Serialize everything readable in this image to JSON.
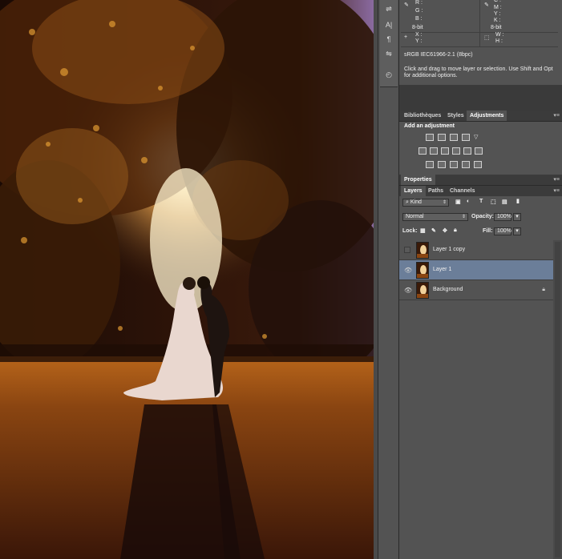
{
  "info_panel": {
    "rgb_labels": [
      "R :",
      "G :",
      "B :"
    ],
    "cmyk_labels": [
      "C :",
      "M :",
      "Y :",
      "K :"
    ],
    "bitdepth_left": "8-bit",
    "bitdepth_right": "8-bit",
    "xy_labels": [
      "X :",
      "Y :"
    ],
    "wh_labels": [
      "W :",
      "H :"
    ],
    "profile": "sRGB IEC61966-2.1 (8bpc)",
    "hint": "Click and drag to move layer or selection.  Use Shift and Opt for additional options."
  },
  "tabs_top": {
    "items": [
      "Bibliothèques",
      "Styles",
      "Adjustments"
    ],
    "active": "Adjustments"
  },
  "adjustments": {
    "title": "Add an adjustment",
    "icons": [
      "brightness-contrast-icon",
      "levels-icon",
      "curves-icon",
      "exposure-icon",
      "vibrance-icon",
      "hue-saturation-icon",
      "color-balance-icon",
      "black-white-icon",
      "photo-filter-icon",
      "channel-mixer-icon",
      "color-lookup-icon",
      "invert-icon",
      "posterize-icon",
      "threshold-icon",
      "selective-color-icon",
      "gradient-map-icon"
    ]
  },
  "properties_tab": "Properties",
  "layer_tabs": {
    "items": [
      "Layers",
      "Paths",
      "Channels"
    ],
    "active": "Layers"
  },
  "layers_panel": {
    "filter_label": "Kind",
    "blend_mode": "Normal",
    "opacity_label": "Opacity:",
    "opacity_value": "100%",
    "lock_label": "Lock:",
    "fill_label": "Fill:",
    "fill_value": "100%",
    "layers": [
      {
        "name": "Layer 1 copy",
        "visible": false,
        "selected": false,
        "locked": false
      },
      {
        "name": "Layer 1",
        "visible": true,
        "selected": true,
        "locked": false
      },
      {
        "name": "Background",
        "visible": true,
        "selected": false,
        "locked": true
      }
    ]
  },
  "colors": {
    "panel_bg": "#535353",
    "selected_row": "#6b7e99",
    "tab_bar": "#3b3b3b"
  }
}
